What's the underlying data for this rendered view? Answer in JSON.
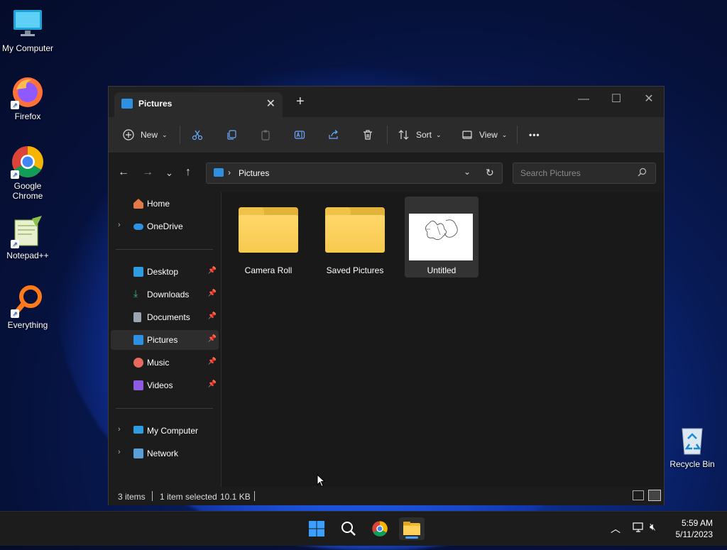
{
  "desktop": {
    "icons": [
      {
        "label": "My Computer",
        "icon": "monitor-icon"
      },
      {
        "label": "Firefox",
        "icon": "firefox-icon"
      },
      {
        "label": "Google Chrome",
        "icon": "chrome-icon"
      },
      {
        "label": "Notepad++",
        "icon": "notepadpp-icon"
      },
      {
        "label": "Everything",
        "icon": "everything-search-icon"
      },
      {
        "label": "Recycle Bin",
        "icon": "recycle-bin-icon"
      }
    ]
  },
  "window": {
    "tab_title": "Pictures",
    "toolbar": {
      "new_label": "New",
      "sort_label": "Sort",
      "view_label": "View",
      "more_label": "•••"
    },
    "address": {
      "crumb": "Pictures",
      "search_placeholder": "Search Pictures"
    },
    "sidebar": {
      "top": [
        {
          "label": "Home"
        },
        {
          "label": "OneDrive"
        }
      ],
      "pinned": [
        {
          "label": "Desktop",
          "color": "#2f9be0"
        },
        {
          "label": "Downloads",
          "color": "#2fbf71"
        },
        {
          "label": "Documents",
          "color": "#9aa6b2"
        },
        {
          "label": "Pictures",
          "color": "#2f8fe0"
        },
        {
          "label": "Music",
          "color": "#e46b5d"
        },
        {
          "label": "Videos",
          "color": "#8d5be0"
        }
      ],
      "bottom": [
        {
          "label": "My Computer"
        },
        {
          "label": "Network"
        }
      ],
      "selected": "Pictures"
    },
    "files": [
      {
        "name": "Camera Roll",
        "type": "folder"
      },
      {
        "name": "Saved Pictures",
        "type": "folder"
      },
      {
        "name": "Untitled",
        "type": "image",
        "selected": true
      }
    ],
    "status": {
      "items": "3 items",
      "selection": "1 item selected",
      "size": "10.1 KB"
    }
  },
  "taskbar": {
    "time": "5:59 AM",
    "date": "5/11/2023"
  },
  "colors": {
    "accent": "#2f8fe0",
    "folder": "#f7c94e"
  }
}
